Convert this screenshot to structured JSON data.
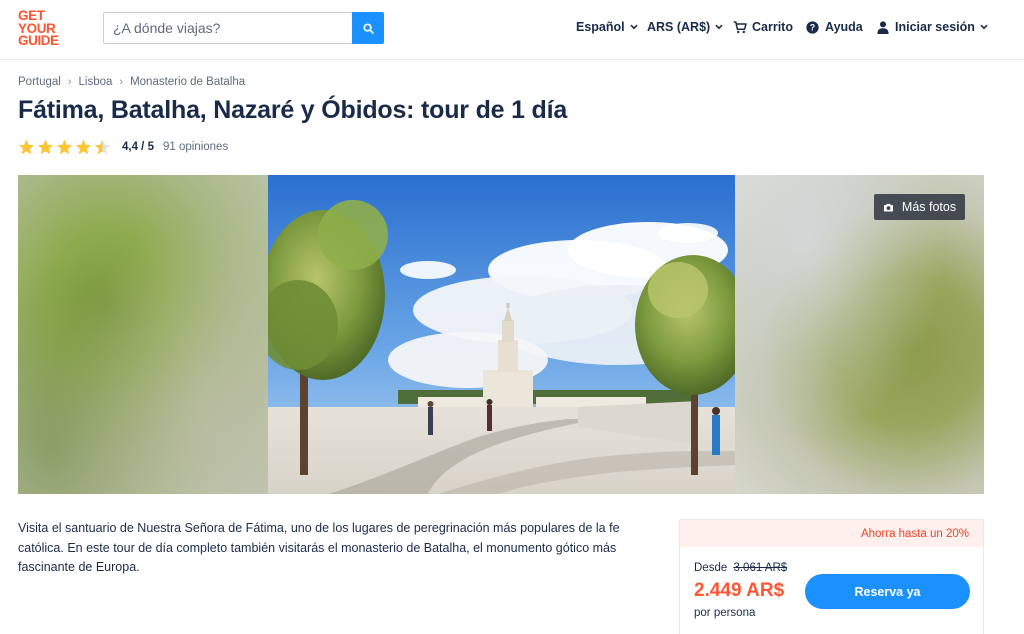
{
  "header": {
    "logo_lines": [
      "GET",
      "YOUR",
      "GUIDE"
    ],
    "search_placeholder": "¿A dónde viajas?",
    "language": "Español",
    "currency": "ARS (AR$)",
    "cart": "Carrito",
    "help": "Ayuda",
    "login": "Iniciar sesión"
  },
  "breadcrumb": [
    "Portugal",
    "Lisboa",
    "Monasterio de Batalha"
  ],
  "title": "Fátima, Batalha, Nazaré y Óbidos: tour de 1 día",
  "rating": {
    "stars": 4.4,
    "score_text": "4,4 / 5",
    "reviews_text": "91 opiniones"
  },
  "gallery": {
    "more_photos": "Más fotos"
  },
  "description": "Visita el santuario de Nuestra Señora de Fátima, uno de los lugares de peregrinación más populares de la fe católica. En este tour de día completo también visitarás el monasterio de Batalha, el monumento gótico más fascinante de Europa.",
  "booking": {
    "savings": "Ahorra hasta un 20%",
    "from_label": "Desde",
    "old_price": "3.061 AR$",
    "price": "2.449 AR$",
    "per_person": "por persona",
    "button": "Reserva ya"
  },
  "colors": {
    "brand": "#ff5533",
    "accent_blue": "#1a91ff",
    "text_dark": "#1a2b49",
    "star": "#fdc433"
  }
}
